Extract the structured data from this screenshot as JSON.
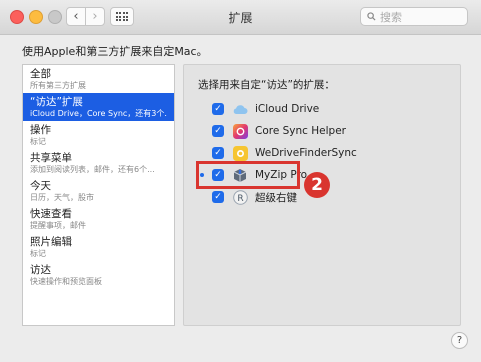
{
  "window": {
    "title": "扩展"
  },
  "toolbar": {
    "back_glyph": "‹",
    "forward_glyph": "›"
  },
  "search": {
    "placeholder": "搜索"
  },
  "heading": "使用Apple和第三方扩展来自定Mac。",
  "sidebar": {
    "items": [
      {
        "title": "全部",
        "subtitle": "所有第三方扩展"
      },
      {
        "title": "“访达”扩展",
        "subtitle": "iCloud Drive，Core Sync，还有3个...",
        "selected": true
      },
      {
        "title": "操作",
        "subtitle": "标记"
      },
      {
        "title": "共享菜单",
        "subtitle": "添加到阅读列表，邮件，还有6个..."
      },
      {
        "title": "今天",
        "subtitle": "日历，天气，股市"
      },
      {
        "title": "快速查看",
        "subtitle": "提醒事项，邮件"
      },
      {
        "title": "照片编辑",
        "subtitle": "标记"
      },
      {
        "title": "访达",
        "subtitle": "快速操作和预览面板"
      }
    ]
  },
  "panel": {
    "label": "选择用来自定“访达”的扩展：",
    "extensions": [
      {
        "name": "iCloud Drive",
        "checked": true,
        "icon": "icloud-icon"
      },
      {
        "name": "Core Sync Helper",
        "checked": true,
        "icon": "core-sync-icon"
      },
      {
        "name": "WeDriveFinderSync",
        "checked": true,
        "icon": "wedrive-icon"
      },
      {
        "name": "MyZip Pro",
        "checked": true,
        "icon": "myzip-icon",
        "highlighted": true
      },
      {
        "name": "超级右键",
        "checked": true,
        "icon": "super-right-click-icon"
      }
    ],
    "check_glyph": "✓"
  },
  "annotation": {
    "badge": "2",
    "color": "#d9352f"
  },
  "help": {
    "glyph": "?"
  },
  "colors": {
    "accent": "#1c5ee3",
    "checkbox": "#1f6bea"
  }
}
